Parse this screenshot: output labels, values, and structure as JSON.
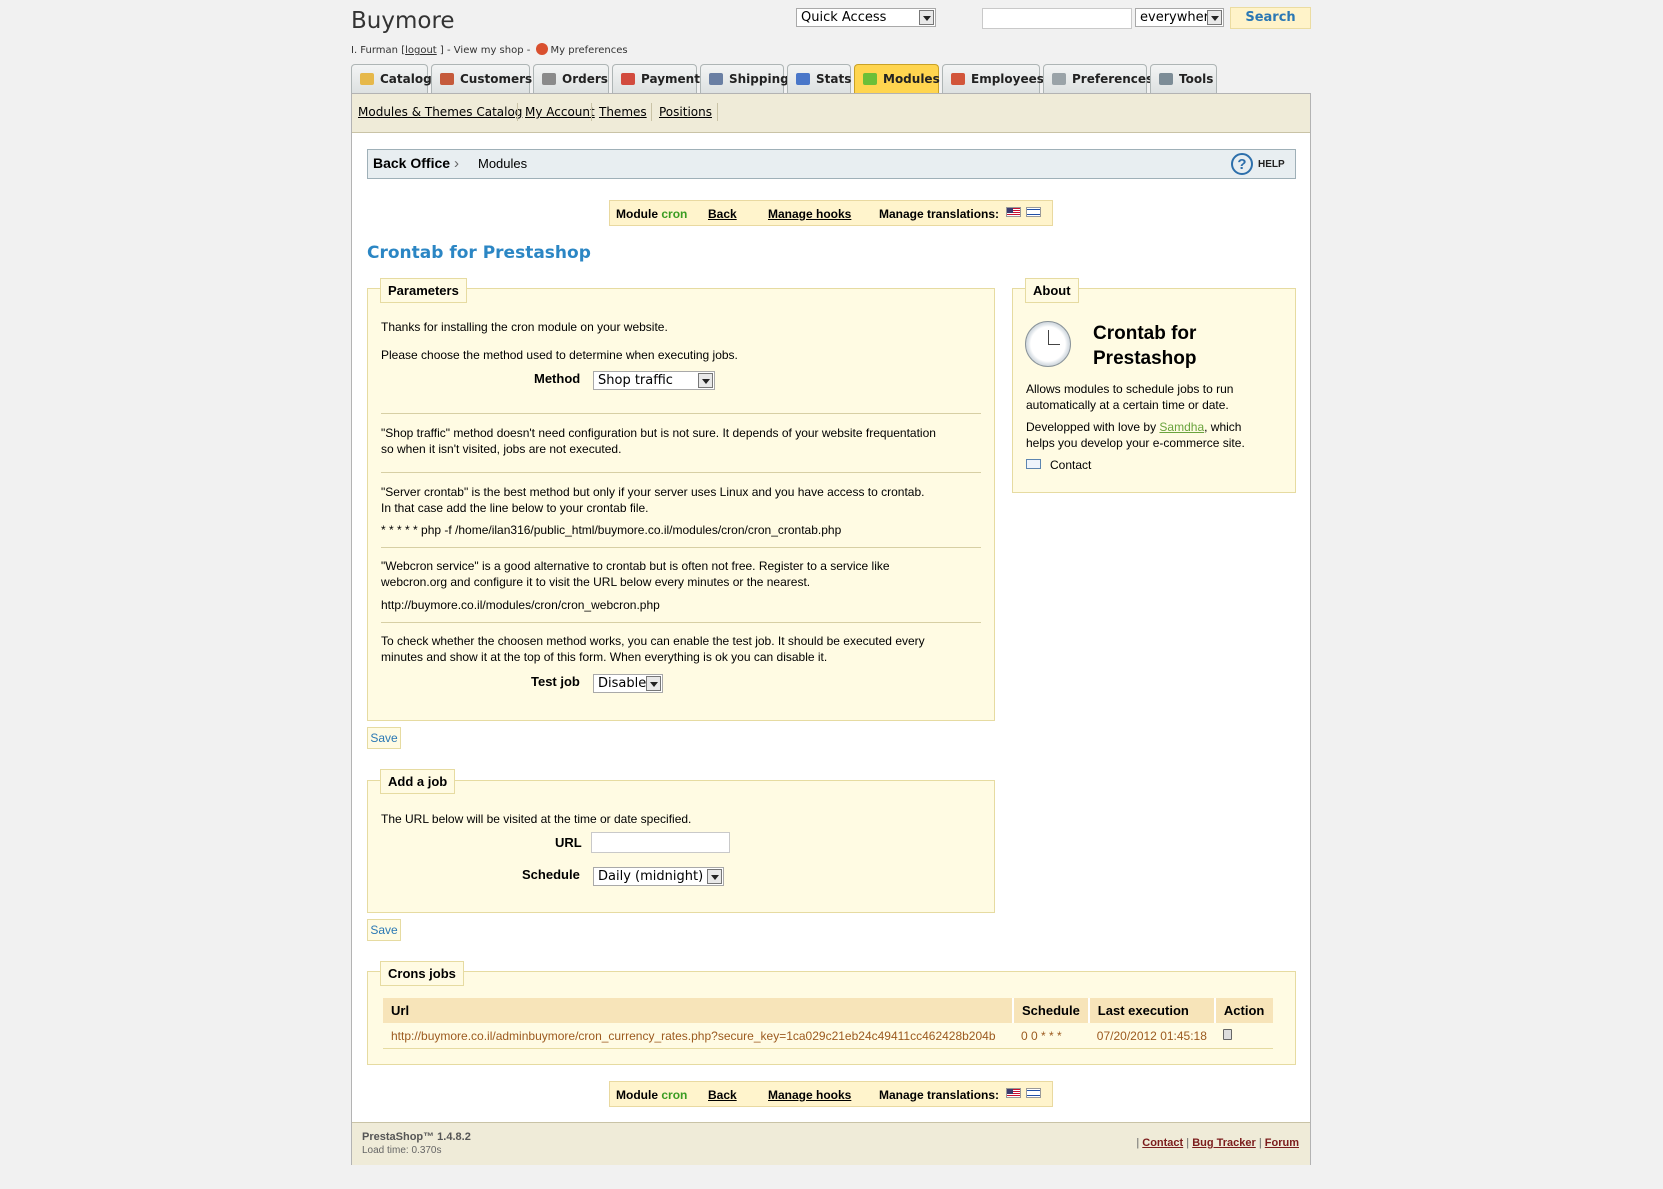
{
  "header": {
    "shop_name": "Buymore",
    "user_name": "I. Furman",
    "bracket_open": "[",
    "logout_label": "logout",
    "bracket_close": "] -",
    "view_shop_label": "View my shop",
    "dash": "-",
    "preferences_label": "My preferences",
    "quick_access": "Quick Access",
    "search_value": "",
    "search_scope": "everywhere",
    "search_button": "Search"
  },
  "tabs": [
    {
      "label": "Catalog",
      "icon": "folder-icon",
      "color": "#e6b84a"
    },
    {
      "label": "Customers",
      "icon": "user-icon",
      "color": "#c55a3b"
    },
    {
      "label": "Orders",
      "icon": "cart-icon",
      "color": "#8a8a8a"
    },
    {
      "label": "Payment",
      "icon": "payment-icon",
      "color": "#d24b3e"
    },
    {
      "label": "Shipping",
      "icon": "truck-icon",
      "color": "#6a7fa3"
    },
    {
      "label": "Stats",
      "icon": "chart-icon",
      "color": "#4a77c9"
    },
    {
      "label": "Modules",
      "icon": "puzzle-icon",
      "color": "#6cbf38",
      "active": true
    },
    {
      "label": "Employees",
      "icon": "employee-icon",
      "color": "#d2553a"
    },
    {
      "label": "Preferences",
      "icon": "preferences-icon",
      "color": "#9aa3a8"
    },
    {
      "label": "Tools",
      "icon": "wrench-icon",
      "color": "#7c8c96"
    }
  ],
  "submenu": [
    "Modules & Themes Catalog",
    "My Account",
    "Themes",
    "Positions"
  ],
  "breadcrumb": {
    "home": "Back Office",
    "separator": "›",
    "current": "Modules",
    "help": "HELP"
  },
  "module_bar": {
    "module_label": "Module",
    "module_name": "cron",
    "back": "Back",
    "manage_hooks": "Manage hooks",
    "manage_translations": "Manage translations:"
  },
  "page_title": "Crontab for Prestashop",
  "parameters": {
    "legend": "Parameters",
    "intro1": "Thanks for installing the cron module on your website.",
    "intro2": "Please choose the method used to determine when executing jobs.",
    "method_label": "Method",
    "method_value": "Shop traffic",
    "shop_traffic_1": "\"Shop traffic\" method doesn't need configuration but is not sure. It depends of your website frequentation",
    "shop_traffic_2": "so when it isn't visited, jobs are not executed.",
    "server_crontab_1": "\"Server crontab\" is the best method but only if your server uses Linux and you have access to crontab.",
    "server_crontab_2": "In that case add the line below to your crontab file.",
    "crontab_line": "* * * * * php -f /home/ilan316/public_html/buymore.co.il/modules/cron/cron_crontab.php",
    "webcron_1": "\"Webcron service\" is a good alternative to crontab but is often not free. Register to a service like",
    "webcron_2": "webcron.org and configure it to visit the URL below every minutes or the nearest.",
    "webcron_url": "http://buymore.co.il/modules/cron/cron_webcron.php",
    "test_1": "To check whether the choosen method works, you can enable the test job. It should be executed every",
    "test_2": "minutes and show it at the top of this form. When everything is ok you can disable it.",
    "test_job_label": "Test job",
    "test_job_value": "Disable",
    "save": "Save"
  },
  "about": {
    "legend": "About",
    "title_line1": "Crontab for",
    "title_line2": "Prestashop",
    "desc1": "Allows modules to schedule jobs to run",
    "desc2": "automatically at a certain time or date.",
    "dev_prefix": "Developped with love by",
    "dev_link": "Samdha",
    "dev_suffix": ", which",
    "dev2": "helps you develop your e-commerce site.",
    "contact": "Contact"
  },
  "add_job": {
    "legend": "Add a job",
    "intro": "The URL below will be visited at the time or date specified.",
    "url_label": "URL",
    "url_value": "",
    "schedule_label": "Schedule",
    "schedule_value": "Daily (midnight)",
    "save": "Save"
  },
  "crons_jobs": {
    "legend": "Crons jobs",
    "columns": [
      "Url",
      "Schedule",
      "Last execution",
      "Action"
    ],
    "rows": [
      {
        "url": "http://buymore.co.il/adminbuymore/cron_currency_rates.php?secure_key=1ca029c21eb24c49411cc462428b204b",
        "schedule": "0 0 * * *",
        "last_execution": "07/20/2012 01:45:18"
      }
    ]
  },
  "footer": {
    "version": "PrestaShop™ 1.4.8.2",
    "load_time": "Load time: 0.370s",
    "sep": "|",
    "contact": "Contact",
    "bug_tracker": "Bug Tracker",
    "forum": "Forum"
  }
}
